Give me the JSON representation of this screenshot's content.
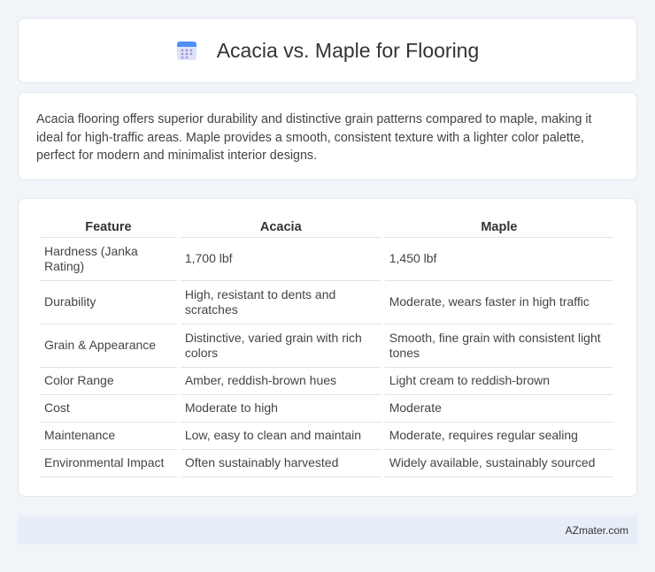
{
  "header": {
    "title": "Acacia vs. Maple for Flooring",
    "icon": "calendar-icon"
  },
  "intro": {
    "text": "Acacia flooring offers superior durability and distinctive grain patterns compared to maple, making it ideal for high-traffic areas. Maple provides a smooth, consistent texture with a lighter color palette, perfect for modern and minimalist interior designs."
  },
  "table": {
    "headers": [
      "Feature",
      "Acacia",
      "Maple"
    ],
    "rows": [
      [
        "Hardness (Janka Rating)",
        "1,700 lbf",
        "1,450 lbf"
      ],
      [
        "Durability",
        "High, resistant to dents and scratches",
        "Moderate, wears faster in high traffic"
      ],
      [
        "Grain & Appearance",
        "Distinctive, varied grain with rich colors",
        "Smooth, fine grain with consistent light tones"
      ],
      [
        "Color Range",
        "Amber, reddish-brown hues",
        "Light cream to reddish-brown"
      ],
      [
        "Cost",
        "Moderate to high",
        "Moderate"
      ],
      [
        "Maintenance",
        "Low, easy to clean and maintain",
        "Moderate, requires regular sealing"
      ],
      [
        "Environmental Impact",
        "Often sustainably harvested",
        "Widely available, sustainably sourced"
      ]
    ]
  },
  "footer": {
    "text": "AZmater.com"
  },
  "colors": {
    "background": "#f1f4f9",
    "card": "#ffffff",
    "footer": "#e8eef7",
    "icon_top": "#4e8ef7",
    "icon_body": "#dde3f5"
  }
}
